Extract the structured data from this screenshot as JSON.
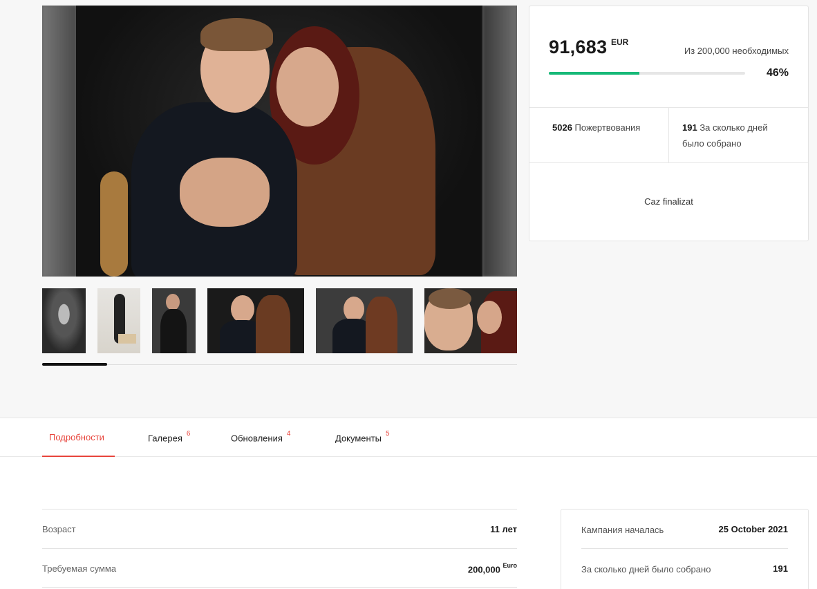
{
  "gallery": {
    "main_alt": "Фото: мальчик с мамой",
    "thumbnails": [
      "thumb-1",
      "thumb-2",
      "thumb-3",
      "thumb-4",
      "thumb-5",
      "thumb-6"
    ]
  },
  "stats": {
    "raised": "91,683",
    "currency": "EUR",
    "goal_text": "Из 200,000 необходимых",
    "progress_fraction": 0.46,
    "percent": "46%",
    "donations_count": "5026",
    "donations_label": "Пожертвования",
    "days_count": "191",
    "days_label_line1": "За сколько дней",
    "days_label_line2": "было собрано",
    "status": "Caz finalizat"
  },
  "tabs": [
    {
      "label": "Подробности",
      "count": ""
    },
    {
      "label": "Галерея",
      "count": "6"
    },
    {
      "label": "Обновления",
      "count": "4"
    },
    {
      "label": "Документы",
      "count": "5"
    }
  ],
  "details": {
    "age_label": "Возраст",
    "age_value": "11 лет",
    "amount_label": "Требуемая сумма",
    "amount_value": "200,000",
    "amount_currency": "Euro"
  },
  "campaign": {
    "started_label": "Кампания началась",
    "started_value": "25 October 2021",
    "days_label": "За сколько дней было собрано",
    "days_value": "191"
  },
  "colors": {
    "accent": "#e8453c",
    "progress": "#17b978"
  }
}
